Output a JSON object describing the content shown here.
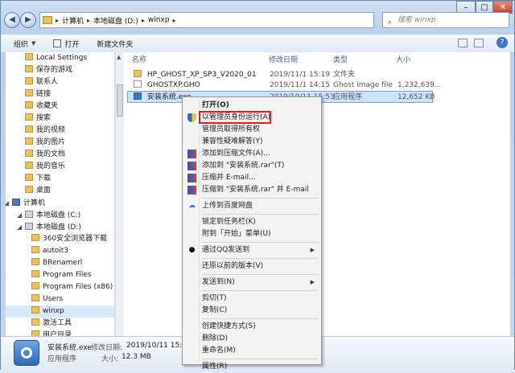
{
  "window": {
    "controls": {
      "minimize": "–",
      "maximize": "□",
      "close": "✕"
    }
  },
  "address": {
    "crumbs": [
      "计算机",
      "本地磁盘 (D:)",
      "winxp"
    ],
    "search_placeholder": "搜索 winxp"
  },
  "toolbar": {
    "organize": "组织",
    "open": "打开",
    "new_folder": "新建文件夹"
  },
  "nav": {
    "items": [
      {
        "label": "Local Settings",
        "level": 2,
        "icon": "folder-icon"
      },
      {
        "label": "保存的游戏",
        "level": 2,
        "icon": "folder-icon"
      },
      {
        "label": "联系人",
        "level": 2,
        "icon": "folder-icon"
      },
      {
        "label": "链接",
        "level": 2,
        "icon": "folder-icon"
      },
      {
        "label": "收藏夹",
        "level": 2,
        "icon": "folder-icon"
      },
      {
        "label": "搜索",
        "level": 2,
        "icon": "folder-icon"
      },
      {
        "label": "我的视频",
        "level": 2,
        "icon": "folder-icon"
      },
      {
        "label": "我的图片",
        "level": 2,
        "icon": "folder-icon"
      },
      {
        "label": "我的文档",
        "level": 2,
        "icon": "folder-icon"
      },
      {
        "label": "我的音乐",
        "level": 2,
        "icon": "folder-icon"
      },
      {
        "label": "下载",
        "level": 2,
        "icon": "folder-icon"
      },
      {
        "label": "桌面",
        "level": 2,
        "icon": "folder-icon"
      },
      {
        "label": "计算机",
        "level": 1,
        "icon": "computer-icon"
      },
      {
        "label": "本地磁盘 (C:)",
        "level": 2,
        "icon": "drive-icon"
      },
      {
        "label": "本地磁盘 (D:)",
        "level": 2,
        "icon": "drive-icon"
      },
      {
        "label": "360安全浏览器下载",
        "level": 3,
        "icon": "folder-icon"
      },
      {
        "label": "autoit3",
        "level": 3,
        "icon": "folder-icon"
      },
      {
        "label": "BRenamerl",
        "level": 3,
        "icon": "folder-icon"
      },
      {
        "label": "Program Files",
        "level": 3,
        "icon": "folder-icon"
      },
      {
        "label": "Program Files (x86)",
        "level": 3,
        "icon": "folder-icon"
      },
      {
        "label": "Users",
        "level": 3,
        "icon": "folder-icon"
      },
      {
        "label": "winxp",
        "level": 3,
        "icon": "folder-icon",
        "selected": true
      },
      {
        "label": "激活工具",
        "level": 3,
        "icon": "folder-icon"
      },
      {
        "label": "用户目录",
        "level": 3,
        "icon": "folder-icon"
      }
    ]
  },
  "columns": {
    "name": "名称",
    "date": "修改日期",
    "type": "类型",
    "size": "大小"
  },
  "files": [
    {
      "name": "HP_GHOST_XP_SP3_V2020_01",
      "date": "2019/11/1 15:19",
      "type": "文件夹",
      "size": ""
    },
    {
      "name": "GHOSTXP.GHO",
      "date": "2019/11/1 14:15",
      "type": "Ghost image file",
      "size": "1,232,639..."
    },
    {
      "name": "安装系统.exe",
      "date": "2019/10/11 15:53",
      "type": "应用程序",
      "size": "12,652 KB"
    }
  ],
  "details": {
    "filename": "安装系统.exe",
    "date_label": "修改日期:",
    "date_value": "2019/10/11 15:53",
    "kind": "应用程序",
    "size_label": "大小:",
    "size_value": "12.3 MB"
  },
  "context_menu": {
    "items": [
      {
        "label": "打开(O)",
        "bold": true
      },
      {
        "label": "以管理员身份运行(A)",
        "icon": "shield-icon",
        "highlighted": true
      },
      {
        "label": "管理员取得所有权"
      },
      {
        "label": "兼容性疑难解答(Y)"
      },
      {
        "label": "添加到压缩文件(A)...",
        "icon": "winrar-icon"
      },
      {
        "label": "添加到 \"安装系统.rar\"(T)",
        "icon": "winrar-icon"
      },
      {
        "label": "压缩并 E-mail...",
        "icon": "winrar-icon"
      },
      {
        "label": "压缩到 \"安装系统.rar\" 并 E-mail",
        "icon": "winrar-icon"
      },
      {
        "sep": true
      },
      {
        "label": "上传到百度网盘",
        "icon": "cloud-icon"
      },
      {
        "sep": true
      },
      {
        "label": "锁定到任务栏(K)"
      },
      {
        "label": "附到「开始」菜单(U)"
      },
      {
        "sep": true
      },
      {
        "label": "通过QQ发送到",
        "icon": "qq-icon",
        "submenu": true
      },
      {
        "sep": true
      },
      {
        "label": "还原以前的版本(V)"
      },
      {
        "sep": true
      },
      {
        "label": "发送到(N)",
        "submenu": true
      },
      {
        "sep": true
      },
      {
        "label": "剪切(T)"
      },
      {
        "label": "复制(C)"
      },
      {
        "sep": true
      },
      {
        "label": "创建快捷方式(S)"
      },
      {
        "label": "删除(D)"
      },
      {
        "label": "重命名(M)"
      },
      {
        "sep": true
      },
      {
        "label": "属性(R)"
      }
    ]
  }
}
